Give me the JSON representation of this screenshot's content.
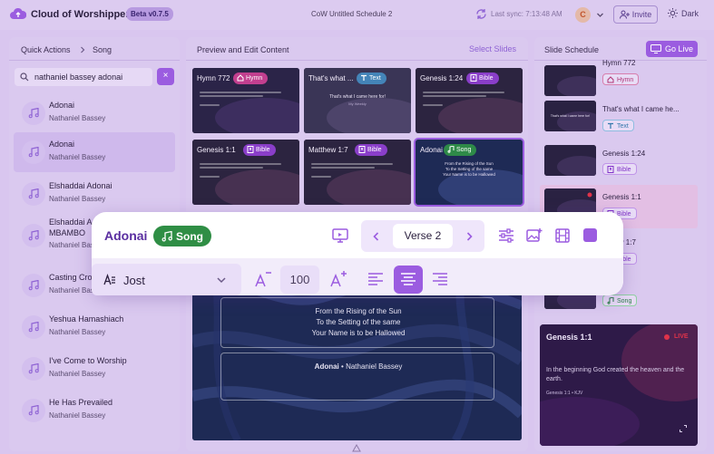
{
  "app": {
    "title": "Cloud of Worshippers",
    "version": "Beta v0.7.5"
  },
  "header": {
    "document_title": "CoW Untitled Schedule 2",
    "sync_text": "Last sync: 7:13:48 AM",
    "avatar_initial": "C",
    "invite_label": "Invite",
    "theme_label": "Dark"
  },
  "left_panel": {
    "breadcrumb": [
      "Quick Actions",
      "Song"
    ],
    "search": {
      "value": "nathaniel bassey adonai",
      "clear_label": "×"
    },
    "songs": [
      {
        "title": "Adonai",
        "author": "Nathaniel Bassey"
      },
      {
        "title": "Adonai",
        "author": "Nathaniel Bassey",
        "selected": true
      },
      {
        "title": "Elshaddai Adonai",
        "author": "Nathaniel Bassey"
      },
      {
        "title": "Elshaddai A...",
        "title2": "MBAMBO",
        "author": "Nathaniel Bassey"
      },
      {
        "title": "Casting Cro...",
        "author": "Nathaniel Bassey"
      },
      {
        "title": "Yeshua Hamashiach",
        "author": "Nathaniel Bassey"
      },
      {
        "title": "I've Come to Worship",
        "author": "Nathaniel Bassey"
      },
      {
        "title": "He Has Prevailed",
        "author": "Nathaniel Bassey"
      }
    ]
  },
  "middle_panel": {
    "title": "Preview and Edit Content",
    "select_slides_label": "Select Slides",
    "tiles": [
      {
        "title": "Hymn 772",
        "tag": "Hymn",
        "kind": "hymn"
      },
      {
        "title": "That's what ...",
        "tag": "Text",
        "kind": "text",
        "body": "That's what I came here for!",
        "sub": "My Weekly"
      },
      {
        "title": "Genesis 1:24",
        "tag": "Bible",
        "kind": "bible"
      },
      {
        "title": "Genesis 1:1",
        "tag": "Bible",
        "kind": "bible"
      },
      {
        "title": "Matthew 1:7",
        "tag": "Bible",
        "kind": "bible"
      },
      {
        "title": "Adonai",
        "tag": "Song",
        "kind": "song",
        "lines": [
          "From the Rising of the Sun",
          "To the Setting of the same",
          "Your Name is to be Hallowed"
        ]
      }
    ],
    "preview": {
      "lyrics": [
        "From the Rising of the Sun",
        "To the Setting of the same",
        "Your Name is to be Hallowed"
      ],
      "credit_title": "Adonai",
      "credit_sep": "•",
      "credit_author": "Nathaniel Bassey"
    }
  },
  "right_panel": {
    "title": "Slide Schedule",
    "go_live_label": "Go Live",
    "items": [
      {
        "label": "Hymn 772",
        "tag": "Hymn",
        "kind": "hymn"
      },
      {
        "label": "That's what I came he...",
        "tag": "Text",
        "kind": "text",
        "thumb_text": "That's what I came here for!"
      },
      {
        "label": "Genesis 1:24",
        "tag": "Bible",
        "kind": "bible"
      },
      {
        "label": "Genesis 1:1",
        "tag": "Bible",
        "kind": "bible",
        "active": true
      },
      {
        "label": "...thew 1:7",
        "tag": "Bible",
        "kind": "bible"
      },
      {
        "label": "...",
        "tag": "Song",
        "kind": "song"
      }
    ],
    "live_preview": {
      "title": "Genesis 1:1",
      "live_label": "LIVE",
      "verse": "In the beginning God created the heaven and the earth.",
      "reference": "Genesis 1:1 • KJV"
    }
  },
  "toolbar": {
    "song_title": "Adonai",
    "song_badge": "Song",
    "verse_label": "Verse 2",
    "font_name": "Jost",
    "font_size": "100"
  },
  "colors": {
    "accent": "#9b5ce0",
    "song_green": "#2f8e45",
    "hymn_pink": "#c23f8f",
    "text_blue": "#4484b8",
    "bible_purple": "#8a3ec9",
    "live_red": "#e0334a"
  }
}
